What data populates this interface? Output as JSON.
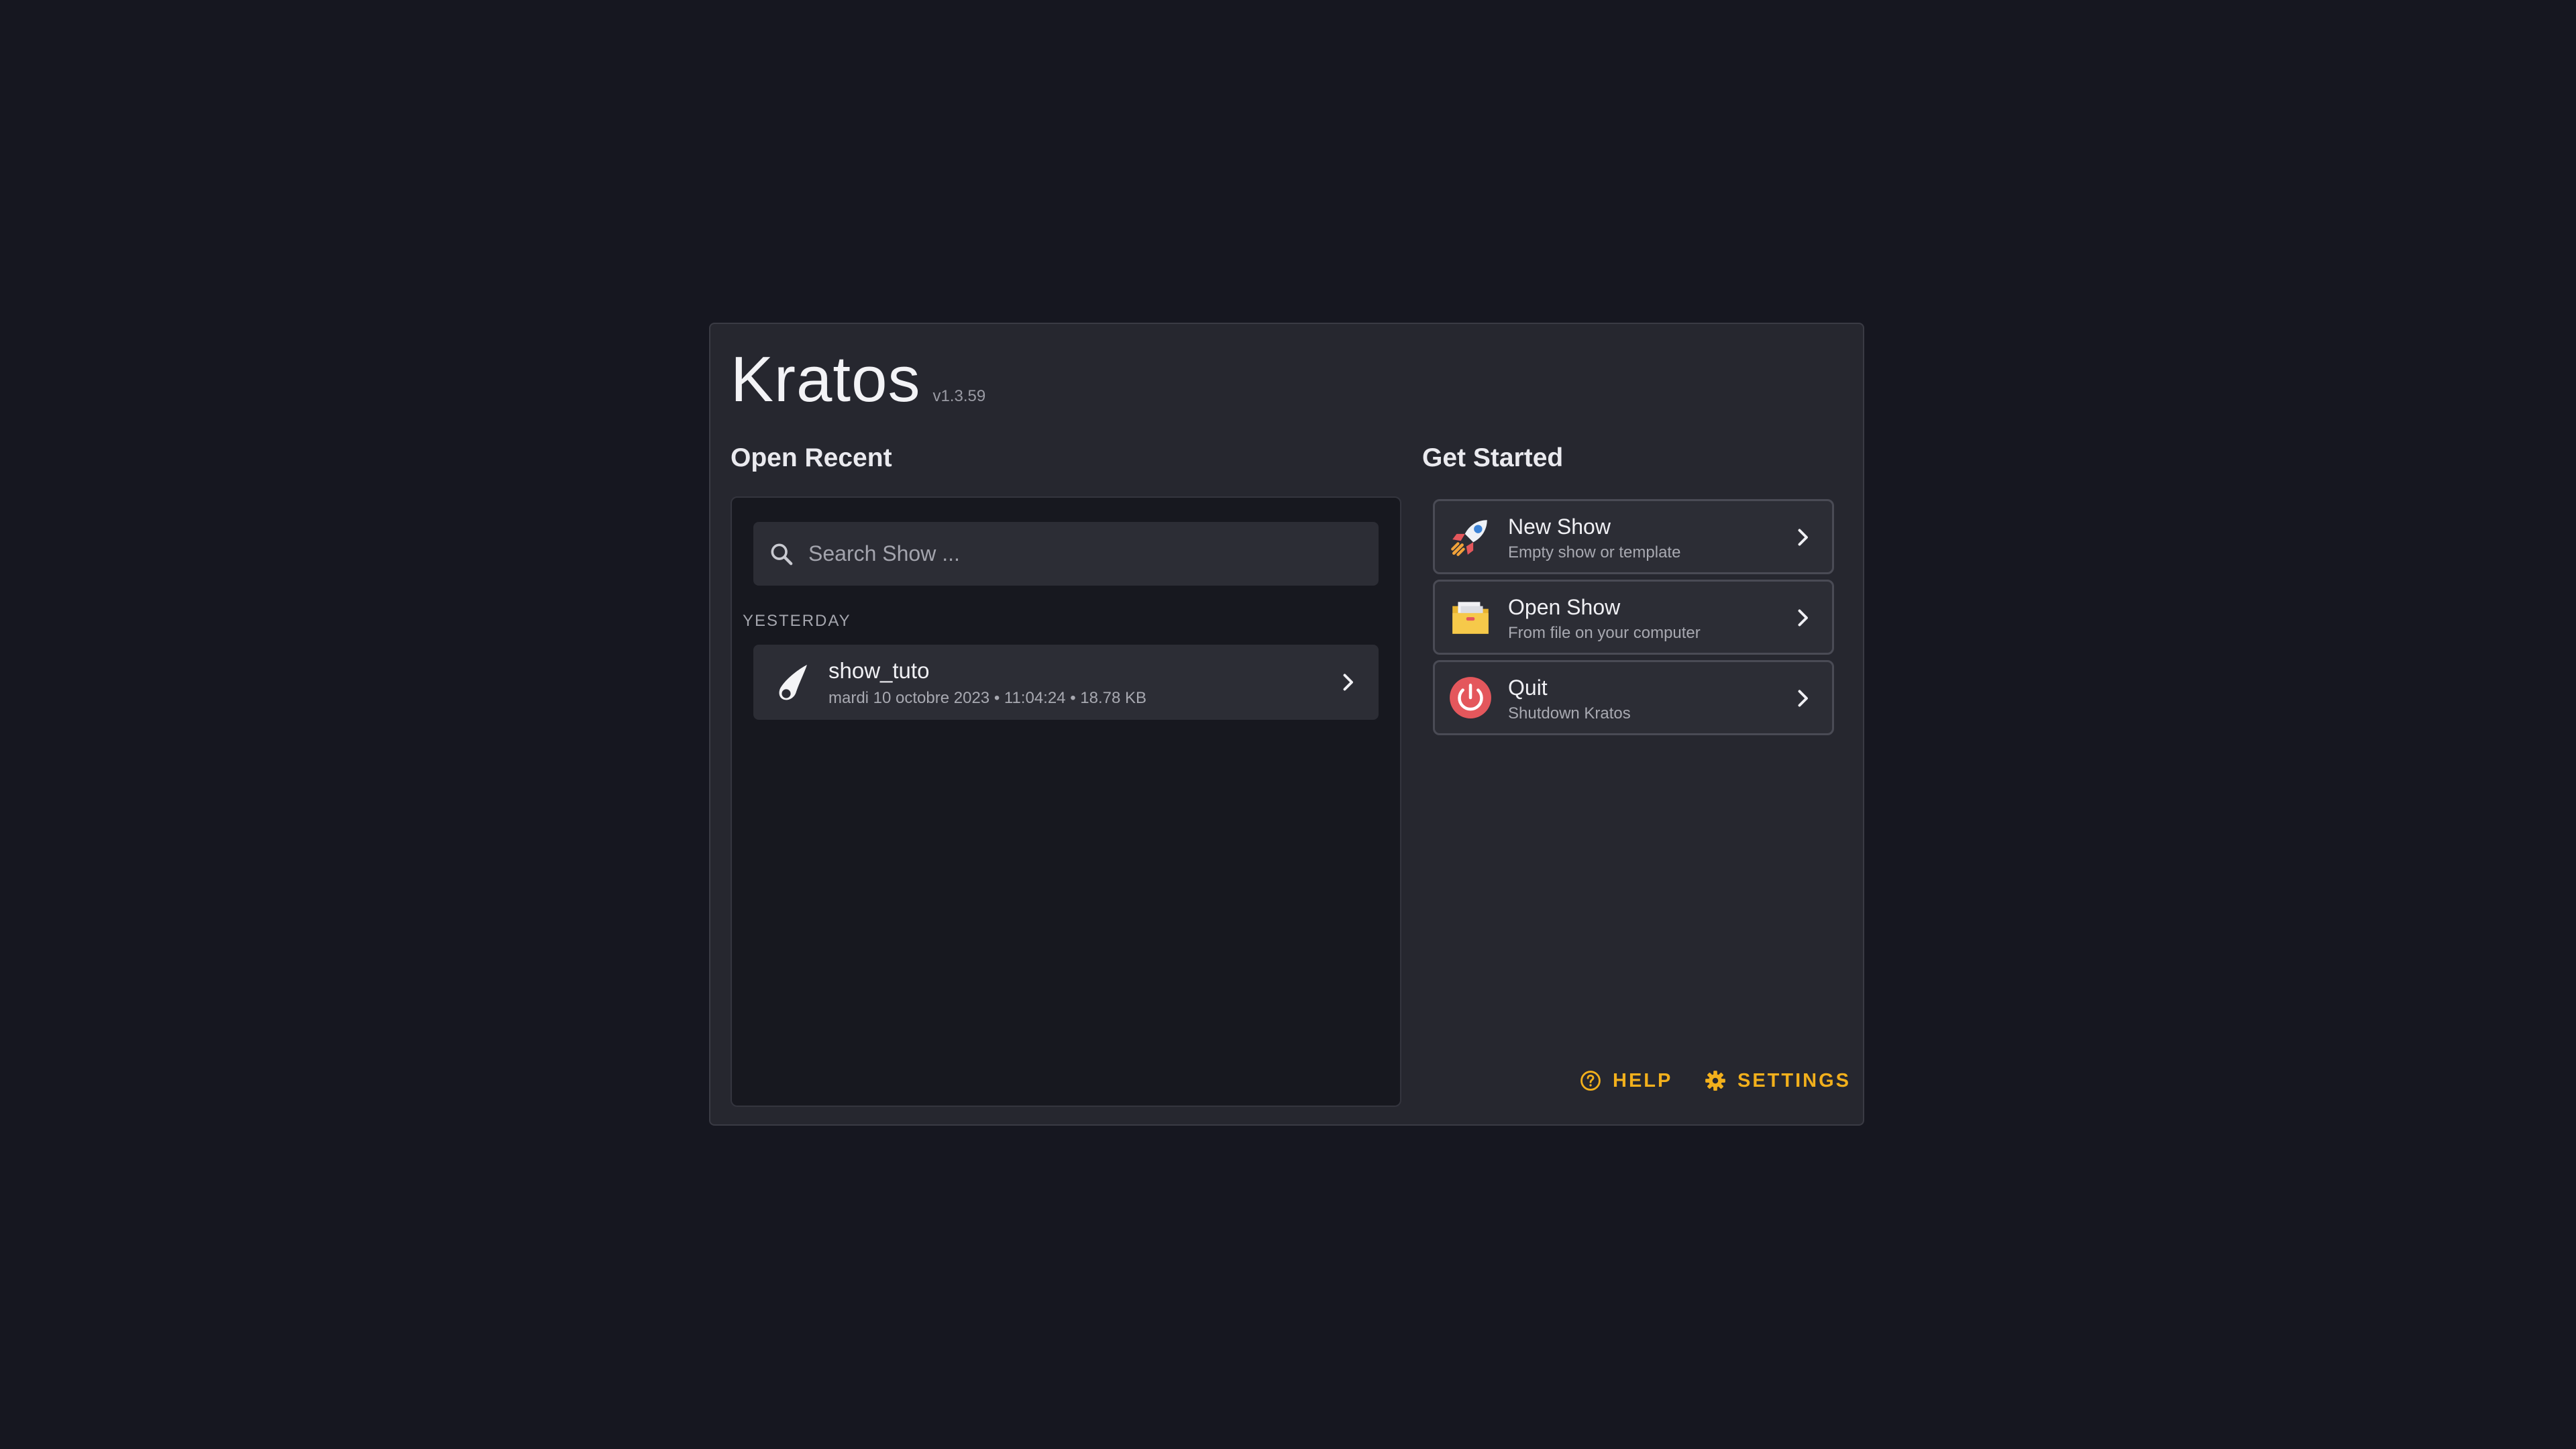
{
  "app": {
    "title": "Kratos",
    "version": "v1.3.59"
  },
  "recent": {
    "heading": "Open Recent",
    "search_placeholder": "Search Show ...",
    "groups": [
      {
        "label": "YESTERDAY",
        "items": [
          {
            "name": "show_tuto",
            "meta": "mardi 10 octobre 2023 • 11:04:24 • 18.78 KB",
            "icon": "comet-icon"
          }
        ]
      }
    ]
  },
  "get_started": {
    "heading": "Get Started",
    "actions": [
      {
        "title": "New Show",
        "subtitle": "Empty show or template",
        "icon": "rocket-icon"
      },
      {
        "title": "Open Show",
        "subtitle": "From file on your computer",
        "icon": "folder-icon"
      },
      {
        "title": "Quit",
        "subtitle": "Shutdown Kratos",
        "icon": "power-icon"
      }
    ]
  },
  "footer": {
    "help_label": "HELP",
    "settings_label": "SETTINGS"
  },
  "colors": {
    "background": "#161720",
    "panel": "#26272f",
    "accent": "#f2b01c",
    "quit": "#e4575c"
  }
}
